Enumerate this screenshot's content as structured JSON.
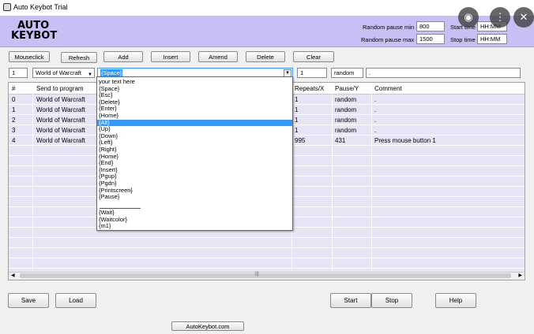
{
  "window": {
    "title": "Auto Keybot Trial"
  },
  "overlay": {
    "lens": "◉",
    "more": "⋮",
    "close": "✕"
  },
  "logo": {
    "line1": "AUTO",
    "line2": "KEYBOT"
  },
  "settings": {
    "pause_min_label": "Random pause min",
    "pause_min_value": "800",
    "pause_max_label": "Random pause max",
    "pause_max_value": "1500",
    "start_time_label": "Start time",
    "start_time_value": "HH:MM",
    "stop_time_label": "Stop time",
    "stop_time_value": "HH:MM"
  },
  "toolbar": {
    "mouseclick": "Mouseclick",
    "refresh": "Refresh",
    "add": "Add",
    "insert": "Insert",
    "amend": "Amend",
    "delete": "Delete",
    "clear": "Clear"
  },
  "entry": {
    "index": "1",
    "program": "World of Warcraft",
    "key": "{Space}",
    "repeats": "1",
    "pause": "random",
    "comment": "."
  },
  "table": {
    "headers": [
      "#",
      "Send to program",
      "Repeats/X",
      "Pause/Y",
      "Comment"
    ],
    "rows": [
      {
        "num": "0",
        "program": "World of Warcraft",
        "repeats": "1",
        "pause": "random",
        "comment": "."
      },
      {
        "num": "1",
        "program": "World of Warcraft",
        "repeats": "1",
        "pause": "random",
        "comment": "."
      },
      {
        "num": "2",
        "program": "World of Warcraft",
        "repeats": "1",
        "pause": "random",
        "comment": "."
      },
      {
        "num": "3",
        "program": "World of Warcraft",
        "repeats": "1",
        "pause": "random",
        "comment": "."
      },
      {
        "num": "4",
        "program": "World of Warcraft",
        "repeats": "995",
        "pause": "431",
        "comment": "Press mouse button 1"
      }
    ]
  },
  "dropdown": {
    "items": [
      "your text here",
      "{Space}",
      "{Esc}",
      "{Delete}",
      "{Enter}",
      "{Home}",
      "{Alt}",
      "{Up}",
      "{Down}",
      "{Left}",
      "{Right}",
      "{Home}",
      "{End}",
      "{Insert}",
      "{Pgup}",
      "{Pgdn}",
      "{Printscreen}",
      "{Pause}"
    ],
    "selected_index": 6,
    "extra_items": [
      "{Wait}",
      "{Waitcolor}",
      "{m1}"
    ]
  },
  "scroll": {
    "grip": "|||"
  },
  "bottom": {
    "save": "Save",
    "load": "Load",
    "start": "Start",
    "stop": "Stop",
    "help": "Help",
    "website": "AutoKeybot.com"
  }
}
